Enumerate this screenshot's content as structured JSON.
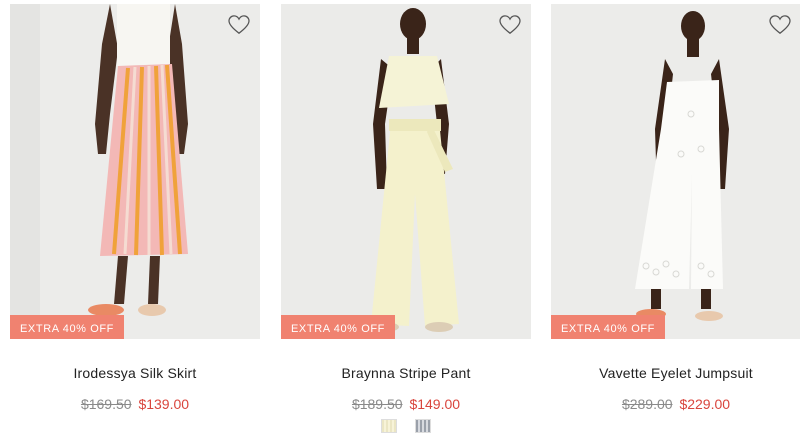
{
  "products": [
    {
      "name": "Irodessya Silk Skirt",
      "original_price": "$169.50",
      "sale_price": "$139.00",
      "badge": "EXTRA 40% OFF",
      "favorite_icon": "heart-outline-icon"
    },
    {
      "name": "Braynna Stripe Pant",
      "original_price": "$189.50",
      "sale_price": "$149.00",
      "badge": "EXTRA 40% OFF",
      "favorite_icon": "heart-outline-icon",
      "swatches": [
        "cream-stripe",
        "grey-stripe"
      ]
    },
    {
      "name": "Vavette Eyelet Jumpsuit",
      "original_price": "$289.00",
      "sale_price": "$229.00",
      "badge": "EXTRA 40% OFF",
      "favorite_icon": "heart-outline-icon"
    }
  ],
  "colors": {
    "badge_bg": "#f08270",
    "sale_price": "#d9453d",
    "original_price": "#8a8a8a"
  }
}
